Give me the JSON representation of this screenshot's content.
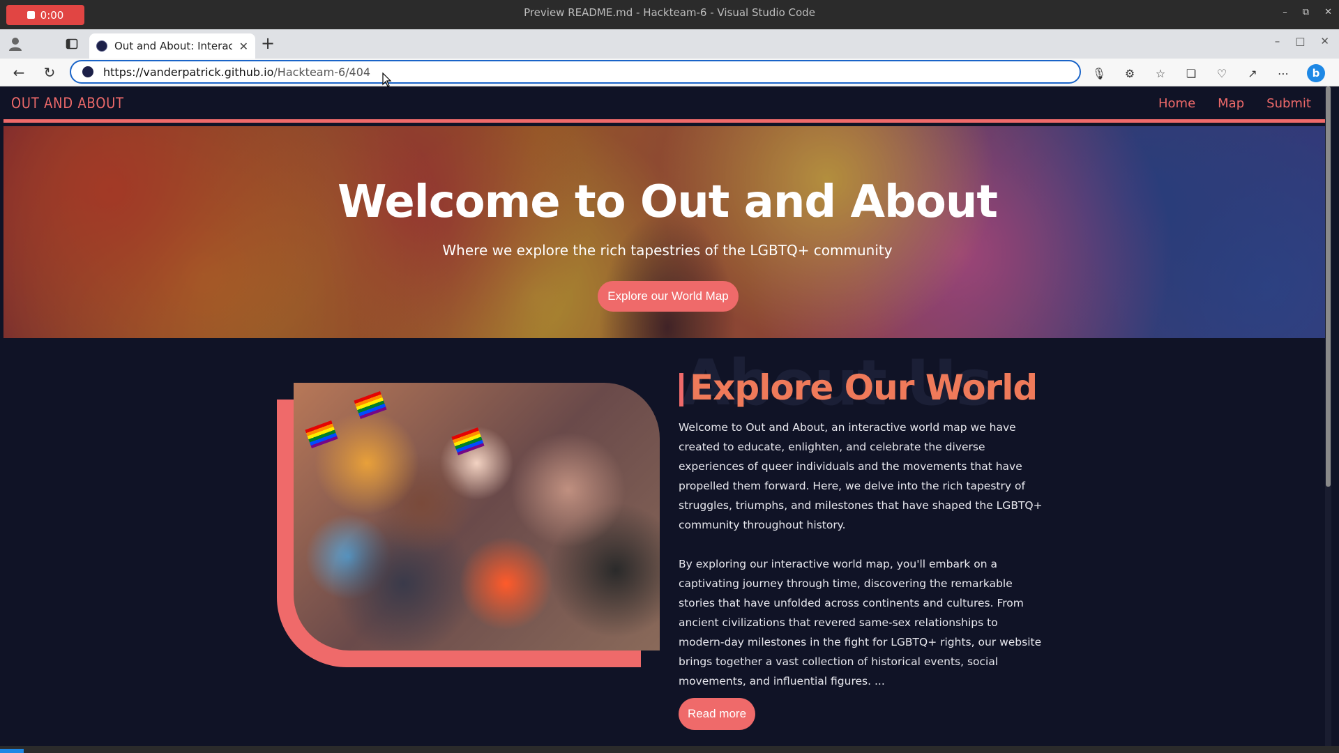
{
  "os": {
    "record_time": "0:00",
    "window_title": "Preview README.md - Hackteam-6 - Visual Studio Code"
  },
  "browser": {
    "tab_title": "Out and About: Interactiv",
    "favicon_text": "",
    "url_domain": "https://vanderpatrick.github.io",
    "url_path": "/Hackteam-6/404",
    "toolbar_icons": [
      "read-aloud-icon",
      "extensions-icon",
      "favorites-icon",
      "collections-icon",
      "browser-essentials-icon",
      "share-icon",
      "more-icon",
      "bing-icon"
    ],
    "bing_label": "b"
  },
  "site": {
    "brand": "OUT AND ABOUT",
    "nav": [
      "Home",
      "Map",
      "Submit"
    ],
    "hero": {
      "title": "Welcome to Out and About",
      "subtitle": "Where we explore the rich tapestries of the LGBTQ+ community",
      "button": "Explore our World Map"
    },
    "about": {
      "background_word": "About Us",
      "title": "Explore Our World",
      "paragraph1": "Welcome to Out and About, an interactive world map we have created to educate, enlighten, and celebrate the diverse experiences of queer individuals and the movements that have propelled them forward. Here, we delve into the rich tapestry of struggles, triumphs, and milestones that have shaped the LGBTQ+ community throughout history.",
      "paragraph2": "By exploring our interactive world map, you'll embark on a captivating journey through time, discovering the remarkable stories that have unfolded across continents and cultures. From ancient civilizations that revered same-sex relationships to modern-day milestones in the fight for LGBTQ+ rights, our website brings together a vast collection of historical events, social movements, and influential figures. ...",
      "button": "Read more"
    }
  },
  "colors": {
    "accent": "#ef6a6a",
    "page_bg": "#101326",
    "title_orange": "#ef7a5a"
  }
}
